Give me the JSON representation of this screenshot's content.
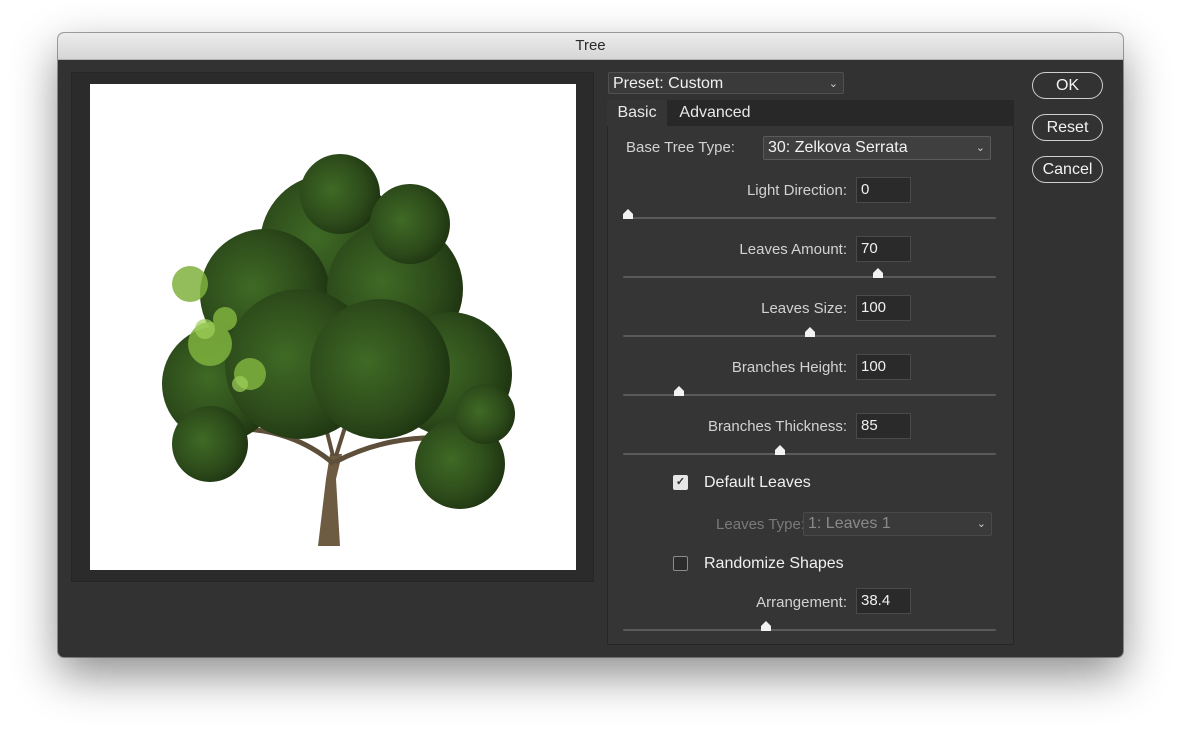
{
  "window": {
    "title": "Tree"
  },
  "preset": {
    "label": "Preset: Custom"
  },
  "tabs": [
    {
      "label": "Basic",
      "active": true
    },
    {
      "label": "Advanced",
      "active": false
    }
  ],
  "base_tree_type": {
    "label": "Base Tree Type:",
    "value": "30: Zelkova Serrata"
  },
  "sliders": [
    {
      "label": "Light Direction:",
      "value": "0",
      "level": 0.0
    },
    {
      "label": "Leaves Amount:",
      "value": "70",
      "level": 0.69
    },
    {
      "label": "Leaves Size:",
      "value": "100",
      "level": 0.5
    },
    {
      "label": "Branches Height:",
      "value": "100",
      "level": 0.14
    },
    {
      "label": "Branches Thickness:",
      "value": "85",
      "level": 0.42
    }
  ],
  "default_leaves": {
    "label": "Default Leaves",
    "checked": true
  },
  "leaves_type": {
    "label": "Leaves Type:",
    "value": "1: Leaves 1",
    "disabled": true
  },
  "randomize_shapes": {
    "label": "Randomize Shapes",
    "checked": false
  },
  "arrangement": {
    "label": "Arrangement:",
    "value": "38.4",
    "level": 0.38
  },
  "buttons": {
    "ok": "OK",
    "reset": "Reset",
    "cancel": "Cancel"
  },
  "icons": {
    "dropdown": "chevron-down-icon",
    "check": "checkmark-icon"
  },
  "colors": {
    "dialog_bg": "#323232",
    "panel_bg": "#353535",
    "leaf_dark": "#2f4d1c",
    "leaf_light": "#8fc24a",
    "trunk": "#6b5a40"
  }
}
